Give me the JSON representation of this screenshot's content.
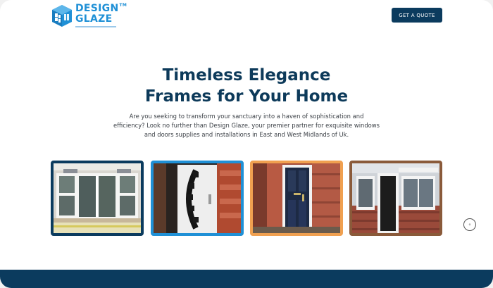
{
  "brand": {
    "line1": "DESIGN",
    "line2": "GLAZE",
    "trademark": "TM",
    "logo_icon": "window-cube-logo",
    "color": "#1f90d6"
  },
  "header": {
    "cta_label": "GET A QUOTE"
  },
  "hero": {
    "title_lines": [
      "Timeless Elegance",
      "Frames for Your Home"
    ],
    "description_lines": [
      "Are you seeking to transform your sanctuary into a haven of sophistication and",
      "efficiency? Look no further than Design Glaze, your premier partner for exquisite windows",
      "and doors supplies and installations in East and West Midlands of Uk."
    ]
  },
  "gallery": {
    "images": [
      {
        "subject": "white-upvc-french-doors",
        "border_color": "#0b3b5e"
      },
      {
        "subject": "white-door-curved-glass",
        "border_color": "#1f90d6"
      },
      {
        "subject": "navy-composite-front-door",
        "border_color": "#f0a050"
      },
      {
        "subject": "white-upvc-windows-porch",
        "border_color": "#8a5a3a"
      }
    ]
  },
  "scroll_top_icon": "arrow-up-icon",
  "colors": {
    "primary_dark": "#0b3b5e",
    "accent_blue": "#1f90d6",
    "accent_orange": "#f0a050",
    "accent_brown": "#8a5a3a"
  }
}
